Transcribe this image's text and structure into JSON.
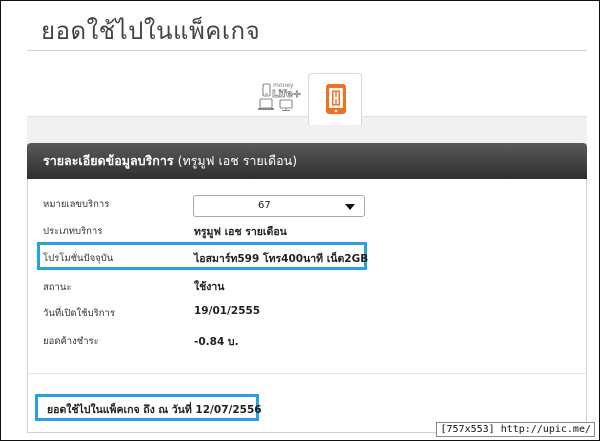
{
  "page": {
    "title": "ยอดใช้ไปในแพ็คเกจ"
  },
  "tabs": [
    {
      "money": "money",
      "life": "Life+"
    },
    {
      "icon": "phone-h-icon",
      "active": true,
      "accent": "#f37021"
    }
  ],
  "card": {
    "header_title": "รายละเอียดข้อมูลบริการ",
    "header_sub": "(ทรูมูฟ เอช รายเดือน)",
    "rows": [
      {
        "label": "หมายเลขบริการ",
        "value": "67",
        "type": "select"
      },
      {
        "label": "ประเภทบริการ",
        "value": "ทรูมูฟ เอช รายเดือน"
      },
      {
        "label": "โปรโมชั่นปัจจุบัน",
        "value": "ไอสมาร์ท599 โทร400นาที เน็ต2GB",
        "highlight": true
      },
      {
        "label": "สถานะ",
        "value": "ใช้งาน"
      },
      {
        "label": "วันที่เปิดใช้บริการ",
        "value": "19/01/2555"
      },
      {
        "label": "ยอดค้างชำระ",
        "value": "-0.84 บ."
      }
    ]
  },
  "footer": {
    "text": "ยอดใช้ไปในแพ็คเกจ ถึง ณ วันที่ 12/07/2556"
  },
  "watermark": "[757x553] http://upic.me/",
  "colors": {
    "highlight_border": "#29a3dc",
    "header_dark": "#3a3a3a",
    "accent_orange": "#f37021"
  }
}
